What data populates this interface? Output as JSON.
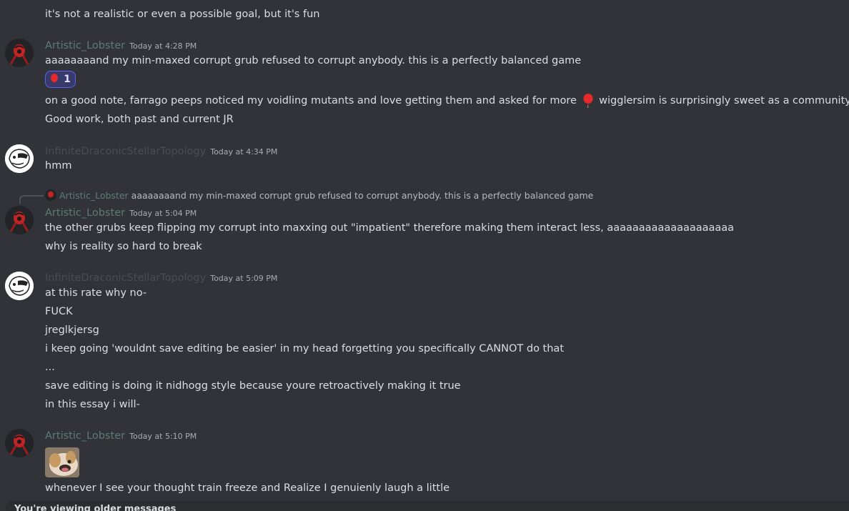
{
  "messages": {
    "m0": {
      "lines": [
        "it's not a realistic or even a possible goal, but it's fun"
      ]
    },
    "m1": {
      "username": "Artistic_Lobster",
      "timestamp": "Today at 4:28 PM",
      "lines": [
        "aaaaaaaand my min-maxed corrupt grub refused to corrupt anybody. this is a perfectly balanced game"
      ],
      "reaction": {
        "emoji": "balloon-icon",
        "count": "1"
      },
      "after_reaction": {
        "line1_start": "on a good note, farrago peeps noticed my voidling mutants and love getting them and asked for more",
        "line1_end": "wigglersim is surprisingly sweet as a community",
        "line2": "Good work, both past and current JR"
      }
    },
    "m2": {
      "username": "InfiniteDraconicStellarTopology",
      "timestamp": "Today at 4:34 PM",
      "lines": [
        "hmm"
      ]
    },
    "m3": {
      "reply": {
        "username": "Artistic_Lobster",
        "text": "aaaaaaaand my min-maxed corrupt grub refused to corrupt anybody. this is a perfectly balanced game"
      },
      "username": "Artistic_Lobster",
      "timestamp": "Today at 5:04 PM",
      "lines": [
        "the other grubs keep flipping my corrupt into maxxing out \"impatient\" therefore making them interact less, aaaaaaaaaaaaaaaaaaaa",
        "why is reality so hard to break"
      ]
    },
    "m4": {
      "username": "InfiniteDraconicStellarTopology",
      "timestamp": "Today at 5:09 PM",
      "lines": [
        "at this rate why no-",
        "FUCK",
        "jreglkjersg",
        "i keep going 'wouldnt save editing be easier' in my head forgetting you specifically CANNOT do that",
        "...",
        "save editing is doing it nidhogg style because youre retroactively making it true",
        "in this essay i will-"
      ]
    },
    "m5": {
      "username": "Artistic_Lobster",
      "timestamp": "Today at 5:10 PM",
      "lines": [
        "whenever I see your thought train freeze and Realize I genuienly laugh a little"
      ]
    }
  },
  "older_messages_bar": {
    "text": "You're viewing older messages"
  },
  "colors": {
    "background": "#313338",
    "text": "#dbdee1",
    "lobster_name": "#5c7d72",
    "infinite_name": "#4a4c52",
    "timestamp": "#a9acb2",
    "reaction_border": "#5865f2",
    "reaction_bg": "#373a6b"
  }
}
